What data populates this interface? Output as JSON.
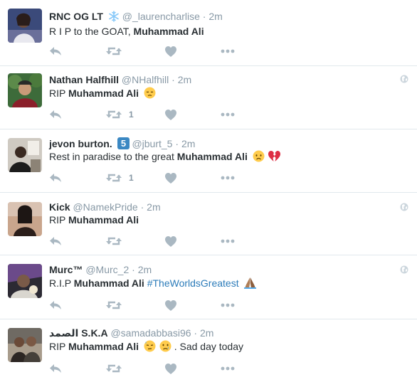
{
  "colors": {
    "icon": "#aab8c2",
    "handle": "#8899a6",
    "link": "#2b7bb9",
    "divider": "#e1e8ed"
  },
  "tweets": [
    {
      "name": "RNC OG LT",
      "badge": "snowflake",
      "handle": "@_laurencharlise",
      "separator": "·",
      "time": "2m",
      "text_plain": "R I P to the GOAT,",
      "text_bold": "Muhammad Ali",
      "text_after": "",
      "hashtag": "",
      "emojis": [],
      "retweets": "",
      "globe": false
    },
    {
      "name": "Nathan Halfhill",
      "badge": "",
      "handle": "@NHalfhill",
      "separator": "·",
      "time": "2m",
      "text_plain": "RIP",
      "text_bold": "Muhammad Ali",
      "text_after": "",
      "hashtag": "",
      "emojis": [
        "pensive-face"
      ],
      "retweets": "1",
      "globe": true
    },
    {
      "name": "jevon burton.",
      "badge": "keycap-5",
      "handle": "@jburt_5",
      "separator": "·",
      "time": "2m",
      "text_plain": "Rest in paradise to the great",
      "text_bold": "Muhammad Ali",
      "text_after": "",
      "hashtag": "",
      "emojis": [
        "disappointed-face",
        "broken-heart"
      ],
      "retweets": "1",
      "globe": false
    },
    {
      "name": "Kick",
      "badge": "",
      "handle": "@NamekPride",
      "separator": "·",
      "time": "2m",
      "text_plain": "RIP",
      "text_bold": "Muhammad Ali",
      "text_after": "",
      "hashtag": "",
      "emojis": [],
      "retweets": "",
      "globe": true
    },
    {
      "name": "Murc™",
      "badge": "",
      "handle": "@Murc_2",
      "separator": "·",
      "time": "2m",
      "text_plain": "R.I.P",
      "text_bold": "Muhammad Ali",
      "text_after": "",
      "hashtag": "#TheWorldsGreatest",
      "emojis": [
        "folded-hands"
      ],
      "retweets": "",
      "globe": true
    },
    {
      "name": "الصمد S.K.A",
      "badge": "",
      "handle": "@samadabbasi96",
      "separator": "·",
      "time": "2m",
      "text_plain": "RIP",
      "text_bold": "Muhammad Ali",
      "text_after": ". Sad day today",
      "hashtag": "",
      "emojis": [
        "downcast-sweat-face",
        "crying-face"
      ],
      "retweets": "",
      "globe": false
    }
  ]
}
